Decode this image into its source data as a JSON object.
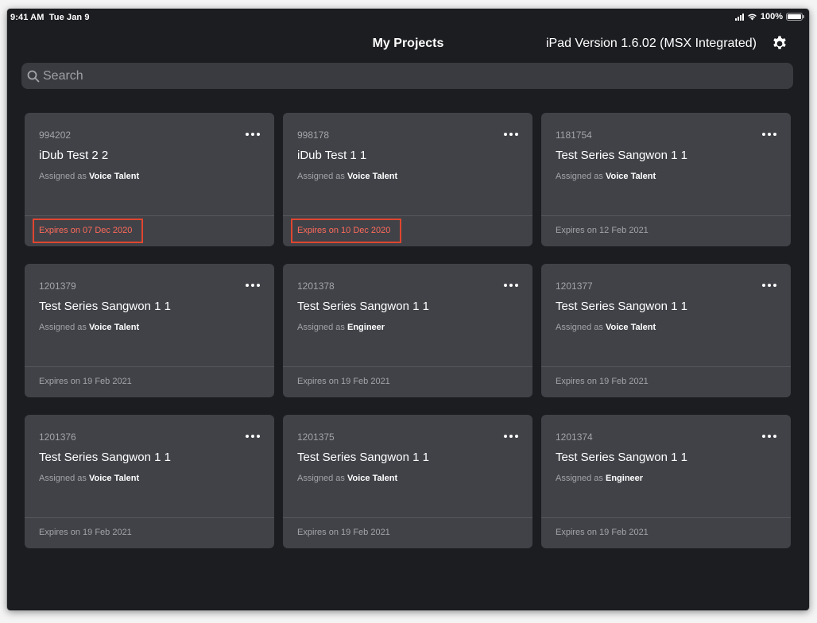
{
  "status_bar": {
    "time": "9:41 AM",
    "date": "Tue Jan 9",
    "battery": "100%"
  },
  "header": {
    "title": "My Projects",
    "version": "iPad Version 1.6.02 (MSX Integrated)",
    "settings_icon": "gear-icon"
  },
  "search": {
    "placeholder": "Search",
    "value": "",
    "icon": "search-icon"
  },
  "colors": {
    "background": "#1c1d21",
    "card": "#404248",
    "search_bg": "#3a3b40",
    "expired_text": "#ff6a5a",
    "highlight_border": "#e0462f",
    "muted_text": "#a3a4aa"
  },
  "projects": [
    {
      "id": "994202",
      "title": "iDub Test 2 2",
      "assigned_prefix": "Assigned as",
      "role": "Voice Talent",
      "expiry": "Expires on 07 Dec 2020",
      "expired": true
    },
    {
      "id": "998178",
      "title": "iDub Test 1 1",
      "assigned_prefix": "Assigned as",
      "role": "Voice Talent",
      "expiry": "Expires on 10 Dec 2020",
      "expired": true
    },
    {
      "id": "1181754",
      "title": "Test Series Sangwon 1 1",
      "assigned_prefix": "Assigned as",
      "role": "Voice Talent",
      "expiry": "Expires on 12 Feb 2021",
      "expired": false
    },
    {
      "id": "1201379",
      "title": "Test Series Sangwon 1 1",
      "assigned_prefix": "Assigned as",
      "role": "Voice Talent",
      "expiry": "Expires on 19 Feb 2021",
      "expired": false
    },
    {
      "id": "1201378",
      "title": "Test Series Sangwon 1 1",
      "assigned_prefix": "Assigned as",
      "role": "Engineer",
      "expiry": "Expires on 19 Feb 2021",
      "expired": false
    },
    {
      "id": "1201377",
      "title": "Test Series Sangwon 1 1",
      "assigned_prefix": "Assigned as",
      "role": "Voice Talent",
      "expiry": "Expires on 19 Feb 2021",
      "expired": false
    },
    {
      "id": "1201376",
      "title": "Test Series Sangwon 1 1",
      "assigned_prefix": "Assigned as",
      "role": "Voice Talent",
      "expiry": "Expires on 19 Feb 2021",
      "expired": false
    },
    {
      "id": "1201375",
      "title": "Test Series Sangwon 1 1",
      "assigned_prefix": "Assigned as",
      "role": "Voice Talent",
      "expiry": "Expires on 19 Feb 2021",
      "expired": false
    },
    {
      "id": "1201374",
      "title": "Test Series Sangwon 1 1",
      "assigned_prefix": "Assigned as",
      "role": "Engineer",
      "expiry": "Expires on 19 Feb 2021",
      "expired": false
    }
  ]
}
